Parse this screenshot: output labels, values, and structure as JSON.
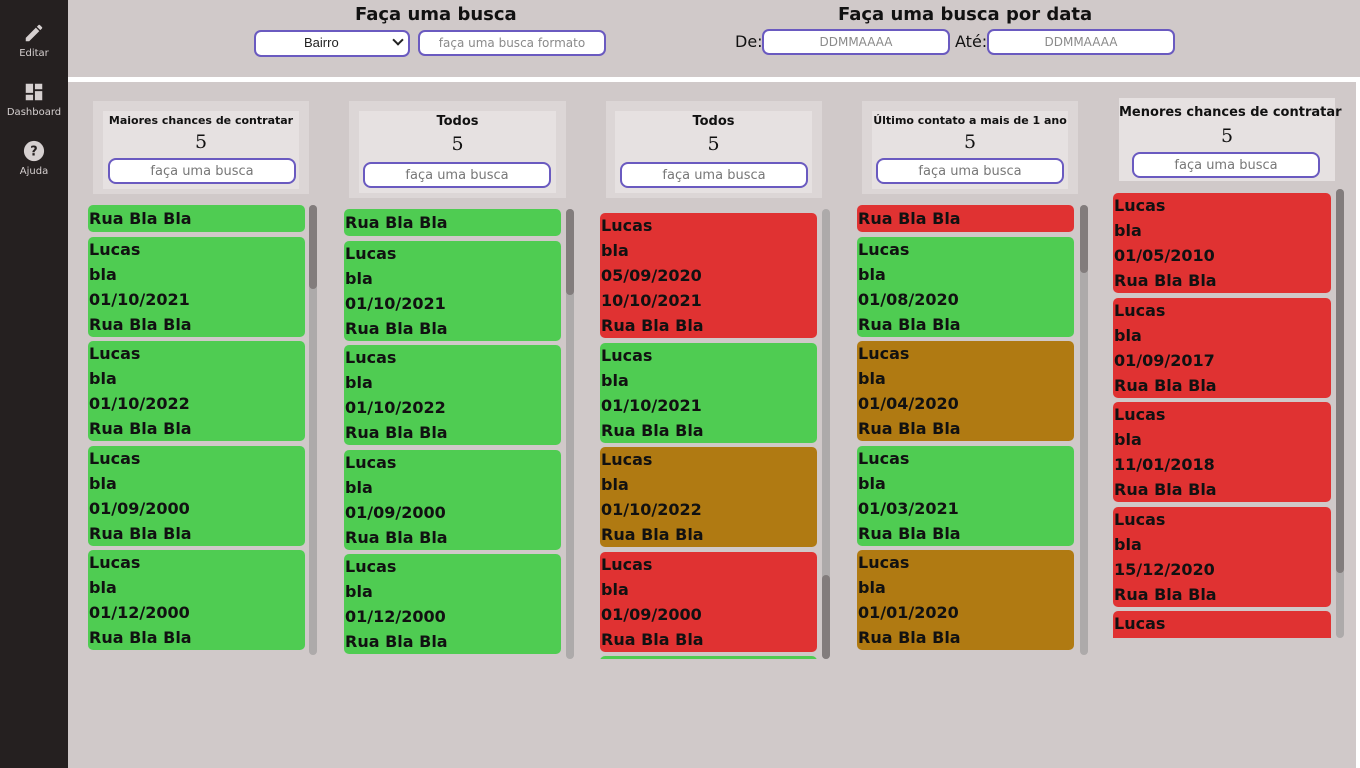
{
  "colors": {
    "green": "#4fcc52",
    "red": "#e03232",
    "brown": "#b07a12",
    "accent": "#6a5ac0"
  },
  "sidebar": {
    "items": [
      {
        "label": "Editar",
        "icon": "pencil-icon"
      },
      {
        "label": "Dashboard",
        "icon": "dashboard-icon"
      },
      {
        "label": "Ajuda",
        "icon": "help-icon"
      }
    ]
  },
  "search": {
    "title": "Faça uma busca",
    "select_value": "Bairro",
    "input_placeholder": "faça uma busca formato"
  },
  "date_search": {
    "title": "Faça uma busca por data",
    "from_label": "De:",
    "to_label": "Até:",
    "from_placeholder": "DDMMAAAA",
    "to_placeholder": "DDMMAAAA"
  },
  "columns": [
    {
      "title": "Maiores chances de contratar",
      "count": "5",
      "search_placeholder": "faça uma busca",
      "cards": [
        {
          "color": "green",
          "lines": [
            "Rua Bla Bla"
          ]
        },
        {
          "color": "green",
          "lines": [
            "Lucas",
            "bla",
            "01/10/2021",
            "Rua Bla Bla"
          ]
        },
        {
          "color": "green",
          "lines": [
            "Lucas",
            "bla",
            "01/10/2022",
            "Rua Bla Bla"
          ]
        },
        {
          "color": "green",
          "lines": [
            "Lucas",
            "bla",
            "01/09/2000",
            "Rua Bla Bla"
          ]
        },
        {
          "color": "green",
          "lines": [
            "Lucas",
            "bla",
            "01/12/2000",
            "Rua Bla Bla"
          ]
        }
      ]
    },
    {
      "title": "Todos",
      "count": "5",
      "search_placeholder": "faça uma busca",
      "cards": [
        {
          "color": "green",
          "lines": [
            "Rua Bla Bla"
          ]
        },
        {
          "color": "green",
          "lines": [
            "Lucas",
            "bla",
            "01/10/2021",
            "Rua Bla Bla"
          ]
        },
        {
          "color": "green",
          "lines": [
            "Lucas",
            "bla",
            "01/10/2022",
            "Rua Bla Bla"
          ]
        },
        {
          "color": "green",
          "lines": [
            "Lucas",
            "bla",
            "01/09/2000",
            "Rua Bla Bla"
          ]
        },
        {
          "color": "green",
          "lines": [
            "Lucas",
            "bla",
            "01/12/2000",
            "Rua Bla Bla"
          ]
        }
      ]
    },
    {
      "title": "Todos",
      "count": "5",
      "search_placeholder": "faça uma busca",
      "cards": [
        {
          "color": "red",
          "lines": [
            "Lucas",
            "bla",
            "05/09/2020",
            "10/10/2021",
            "Rua Bla Bla"
          ]
        },
        {
          "color": "green",
          "lines": [
            "Lucas",
            "bla",
            "01/10/2021",
            "Rua Bla Bla"
          ]
        },
        {
          "color": "brown",
          "lines": [
            "Lucas",
            "bla",
            "01/10/2022",
            "Rua Bla Bla"
          ]
        },
        {
          "color": "red",
          "lines": [
            "Lucas",
            "bla",
            "01/09/2000",
            "Rua Bla Bla"
          ]
        },
        {
          "color": "green",
          "lines": []
        }
      ]
    },
    {
      "title": "Último contato a mais de 1 ano",
      "count": "5",
      "search_placeholder": "faça uma busca",
      "cards": [
        {
          "color": "red",
          "lines": [
            "Rua Bla Bla"
          ]
        },
        {
          "color": "green",
          "lines": [
            "Lucas",
            "bla",
            "01/08/2020",
            "Rua Bla Bla"
          ]
        },
        {
          "color": "brown",
          "lines": [
            "Lucas",
            "bla",
            "01/04/2020",
            "Rua Bla Bla"
          ]
        },
        {
          "color": "green",
          "lines": [
            "Lucas",
            "bla",
            "01/03/2021",
            "Rua Bla Bla"
          ]
        },
        {
          "color": "brown",
          "lines": [
            "Lucas",
            "bla",
            "01/01/2020",
            "Rua Bla Bla"
          ]
        }
      ]
    },
    {
      "title": "Menores chances de contratar",
      "count": "5",
      "search_placeholder": "faça uma busca",
      "cards": [
        {
          "color": "red",
          "lines": [
            "Lucas",
            "bla",
            "01/05/2010",
            "Rua Bla Bla"
          ]
        },
        {
          "color": "red",
          "lines": [
            "Lucas",
            "bla",
            "01/09/2017",
            "Rua Bla Bla"
          ]
        },
        {
          "color": "red",
          "lines": [
            "Lucas",
            "bla",
            "11/01/2018",
            "Rua Bla Bla"
          ]
        },
        {
          "color": "red",
          "lines": [
            "Lucas",
            "bla",
            "15/12/2020",
            "Rua Bla Bla"
          ]
        },
        {
          "color": "red",
          "lines": [
            "Lucas"
          ]
        }
      ]
    }
  ]
}
